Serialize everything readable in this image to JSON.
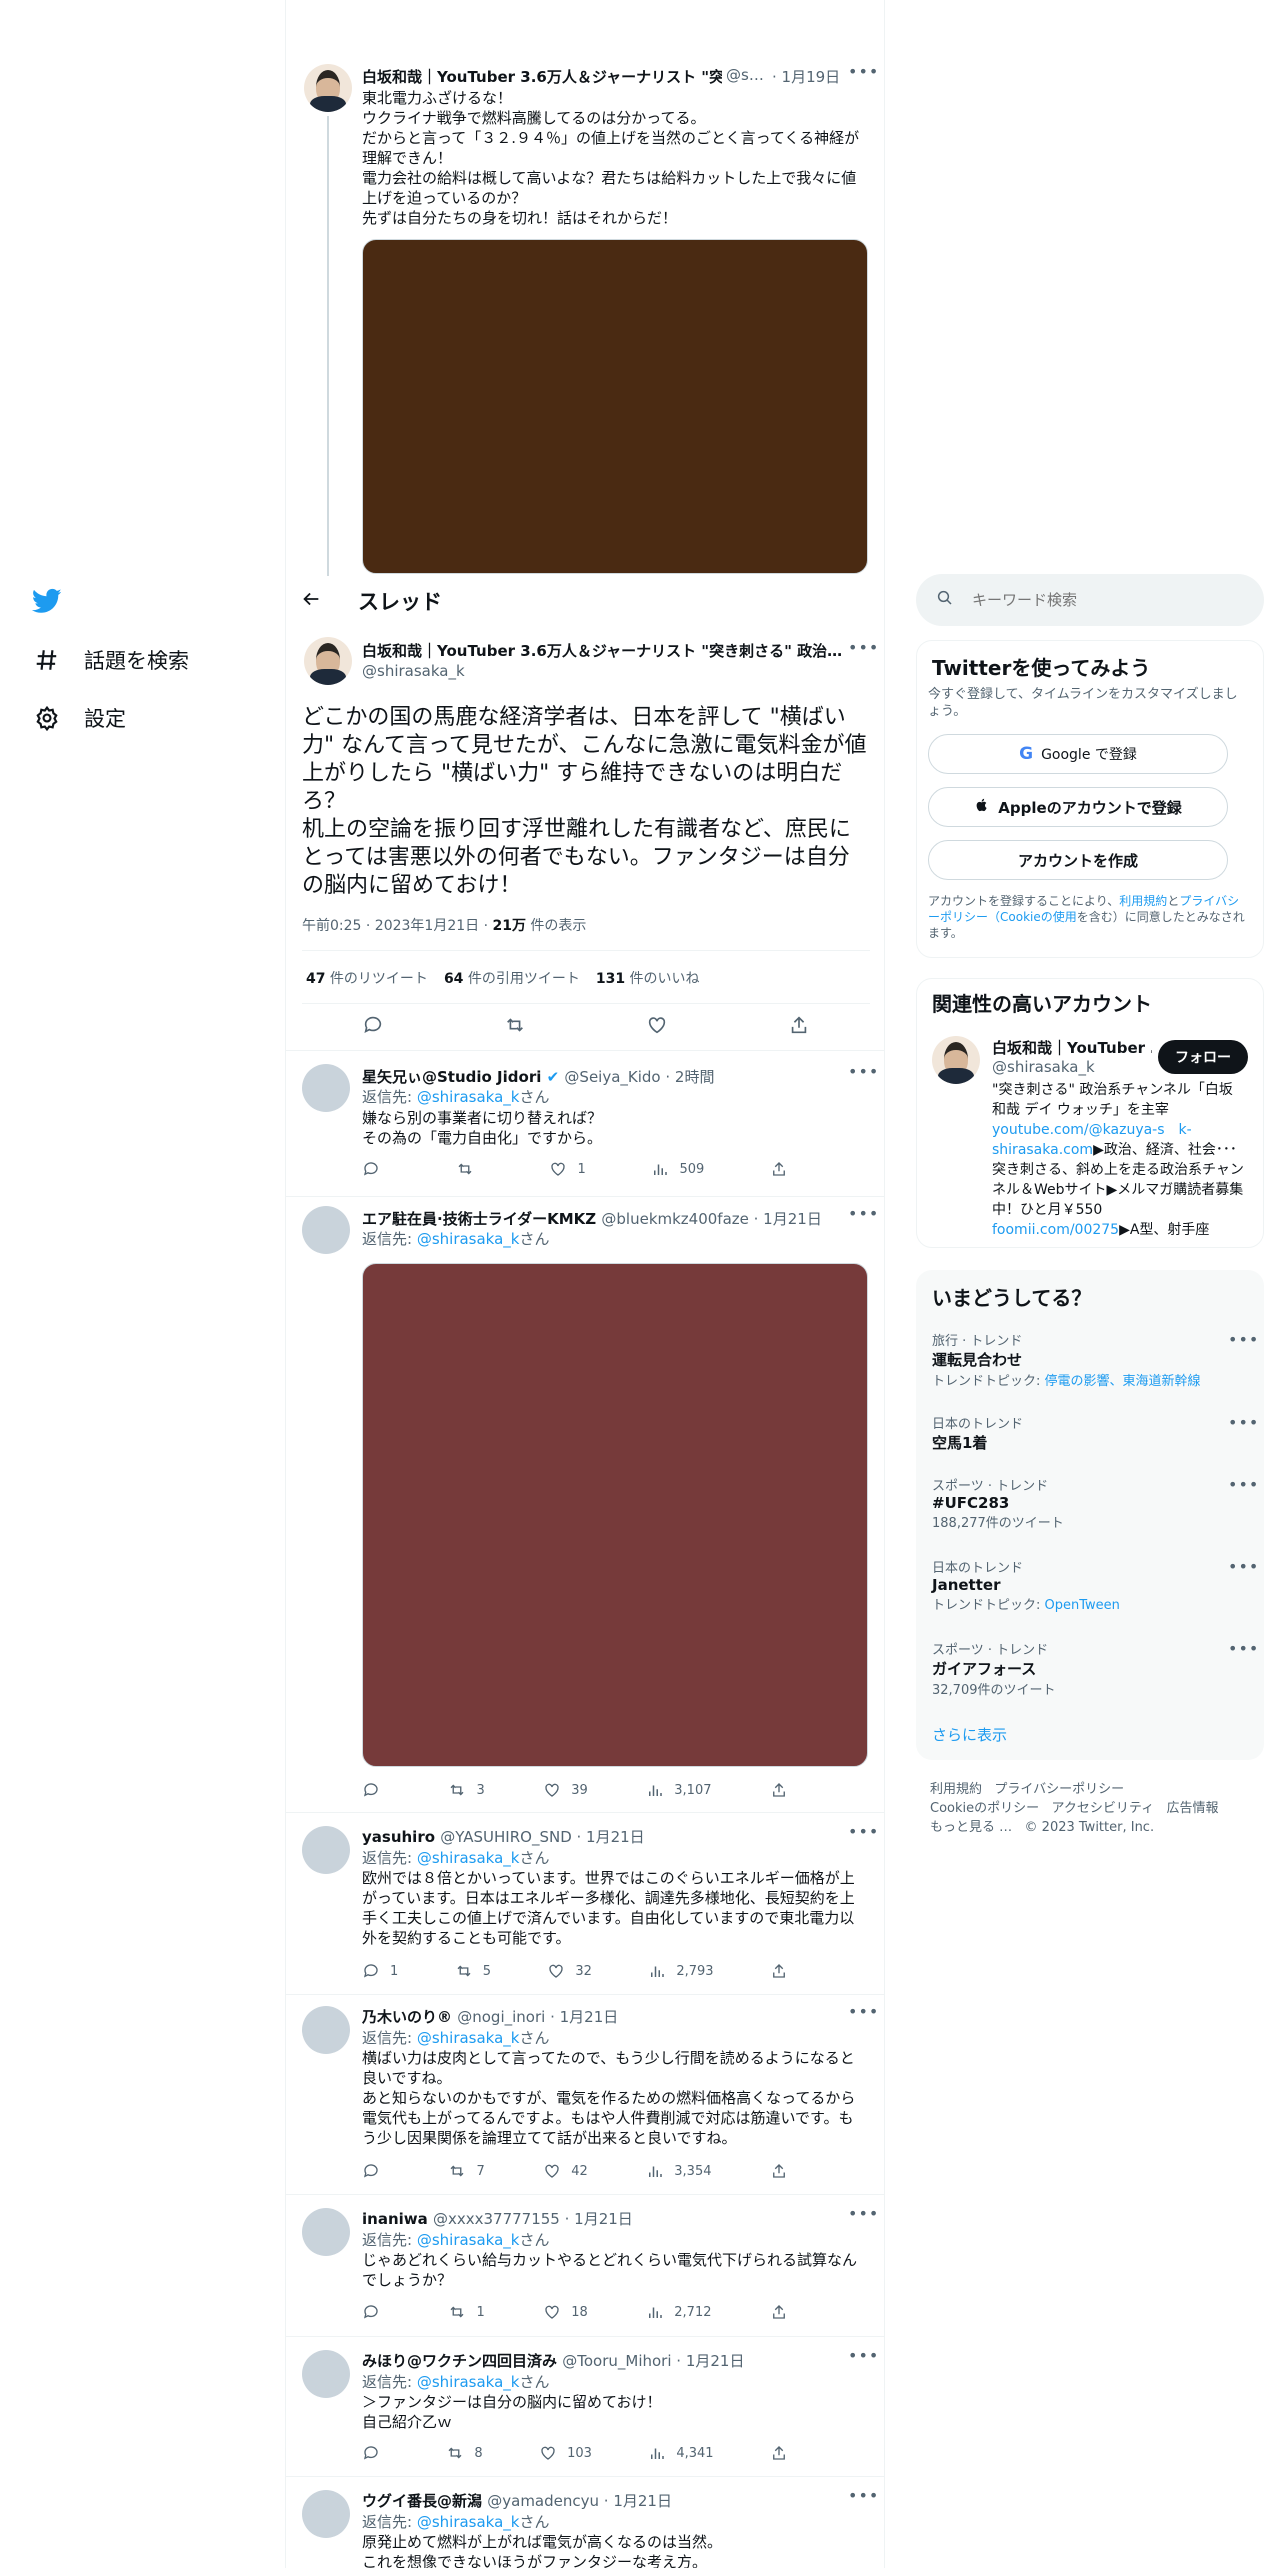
{
  "nav": {
    "explore_label": "話題を検索",
    "settings_label": "設定"
  },
  "thread_header": {
    "title": "スレッド"
  },
  "top_tweet": {
    "name": "白坂和哉｜YouTuber 3.6万人＆ジャーナリスト \"突…",
    "handle": "@s…",
    "date": "· 1月19日",
    "text": "東北電力ふざけるな！\nウクライナ戦争で燃料高騰してるのは分かってる。\nだからと言って「３２.９４％」の値上げを当然のごとく言ってくる神経が理解できん！\n電力会社の給料は概して高いよな？君たちは給料カットした上で我々に値上げを迫っているのか？\n先ずは自分たちの身を切れ！話はそれからだ！",
    "media_color": "#4a2a12"
  },
  "main_tweet": {
    "name": "白坂和哉｜YouTuber 3.6万人＆ジャーナリスト \"突き刺さる\" 政治…",
    "handle": "@shirasaka_k",
    "text": "どこかの国の馬鹿な経済学者は、日本を評して \"横ばい力\" なんて言って見せたが、こんなに急激に電気料金が値上がりしたら \"横ばい力\" すら維持できないのは明白だろ？\n机上の空論を振り回す浮世離れした有識者など、庶民にとっては害悪以外の何者でもない。ファンタジーは自分の脳内に留めておけ！",
    "time": "午前0:25 · 2023年1月21日 · ",
    "views_count": "21万",
    "views_label": " 件の表示",
    "retweets_count": "47",
    "retweets_label": " 件のリツイート",
    "quotes_count": "64",
    "quotes_label": " 件の引用ツイート",
    "likes_count": "131",
    "likes_label": " 件のいいね"
  },
  "reply_prefix": "返信先: ",
  "reply_handle": "@shirasaka_k",
  "reply_suffix": "さん",
  "replies": [
    {
      "name": "星矢兄ぃ@Studio Jidori",
      "handle": "@Seiya_Kido · 2時間",
      "text": "嫌なら別の事業者に切り替えれば？\nその為の「電力自由化」ですから。",
      "replies": "",
      "retweets": "",
      "likes": "1",
      "views": "509"
    },
    {
      "name": "エア駐在員·技術士ライダーKMKZ",
      "handle": "@bluekmkz400faze · 1月21日",
      "text": "",
      "media_color": "#763a3a",
      "replies": "",
      "retweets": "3",
      "likes": "39",
      "views": "3,107"
    },
    {
      "name": "yasuhiro",
      "handle": "@YASUHIRO_SND · 1月21日",
      "text": "欧州では８倍とかいっています。世界ではこのぐらいエネルギー価格が上がっています。日本はエネルギー多様化、調達先多様地化、長短契約を上手く工夫しこの値上げで済んでいます。自由化していますので東北電力以外を契約することも可能です。",
      "replies": "1",
      "retweets": "5",
      "likes": "32",
      "views": "2,793"
    },
    {
      "name": "乃木いのり®",
      "handle": "@nogi_inori · 1月21日",
      "text": "横ばい力は皮肉として言ってたので、もう少し行間を読めるようになると良いですね。\nあと知らないのかもですが、電気を作るための燃料価格高くなってるから電気代も上がってるんですよ。もはや人件費削減で対応は筋違いです。もう少し因果関係を論理立てて話が出来ると良いですね。",
      "replies": "",
      "retweets": "7",
      "likes": "42",
      "views": "3,354"
    },
    {
      "name": "inaniwa",
      "handle": "@xxxx37777155 · 1月21日",
      "text": "じゃあどれくらい給与カットやるとどれくらい電気代下げられる試算なんでしょうか？",
      "replies": "",
      "retweets": "1",
      "likes": "18",
      "views": "2,712"
    },
    {
      "name": "みほり@ワクチン四回目済み",
      "handle": "@Tooru_Mihori · 1月21日",
      "text": "＞ファンタジーは自分の脳内に留めておけ！\n自己紹介乙ｗ",
      "replies": "",
      "retweets": "8",
      "likes": "103",
      "views": "4,341"
    },
    {
      "name": "ウグイ番長@新潟",
      "handle": "@yamadencyu · 1月21日",
      "text": "原発止めて燃料が上がれば電気が高くなるのは当然。\nこれを想像できないほうがファンタジーな考え方。"
    }
  ],
  "search": {
    "placeholder": "キーワード検索"
  },
  "signup": {
    "title": "Twitterを使ってみよう",
    "subtitle": "今すぐ登録して、タイムラインをカスタマイズしましょう。",
    "google_label": "Google で登録",
    "apple_label": "Appleのアカウントで登録",
    "create_label": "アカウントを作成",
    "terms_pre": "アカウントを登録することにより、",
    "terms_link1": "利用規約",
    "terms_mid": "と",
    "terms_link2": "プライバシーポリシー（Cookieの使用",
    "terms_post": "を含む）に同意したとみなされます。"
  },
  "relevant": {
    "title": "関連性の高いアカウント",
    "name": "白坂和哉｜YouTuber …",
    "handle": "@shirasaka_k",
    "follow_label": "フォロー",
    "bio_1": "\"突き刺さる\" 政治系チャンネル「白坂和哉 デイ ウォッチ」を主宰",
    "bio_link1": "youtube.com/@kazuya-s　k-shirasaka.com",
    "bio_2": "▶政治、経済、社会･･･突き刺さる、斜め上を走る政治系チャンネル＆Webサイト▶メルマガ購読者募集中！ひと月￥550",
    "bio_link2": "foomii.com/00275",
    "bio_3": "▶A型、射手座"
  },
  "trends": {
    "title": "いまどうしてる？",
    "items": [
      {
        "category": "旅行 · トレンド",
        "name": "運転見合わせ",
        "sub_prefix": "トレンドトピック: ",
        "sub_link": "停電の影響、東海道新幹線",
        "sub": ""
      },
      {
        "category": "日本のトレンド",
        "name": "空馬1着",
        "sub_prefix": "",
        "sub_link": "",
        "sub": ""
      },
      {
        "category": "スポーツ · トレンド",
        "name": "#UFC283",
        "sub_prefix": "",
        "sub_link": "",
        "sub": "188,277件のツイート"
      },
      {
        "category": "日本のトレンド",
        "name": "Janetter",
        "sub_prefix": "トレンドトピック: ",
        "sub_link": "OpenTween",
        "sub": ""
      },
      {
        "category": "スポーツ · トレンド",
        "name": "ガイアフォース",
        "sub_prefix": "",
        "sub_link": "",
        "sub": "32,709件のツイート"
      }
    ],
    "show_more": "さらに表示"
  },
  "footer": {
    "links": [
      "利用規約",
      "プライバシーポリシー",
      "Cookieのポリシー",
      "アクセシビリティ",
      "広告情報",
      "もっと見る …"
    ],
    "copyright": "© 2023 Twitter, Inc."
  },
  "colors": {
    "accent": "#1d9bf0",
    "text": "#0f1419",
    "muted": "#536471"
  }
}
